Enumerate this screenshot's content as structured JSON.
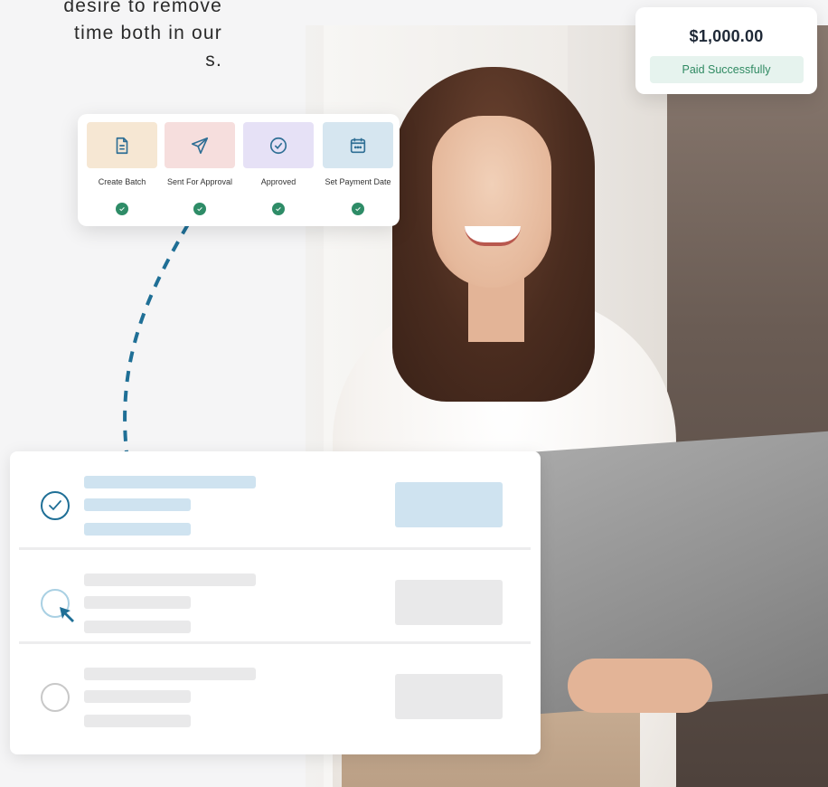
{
  "intro": {
    "lines": [
      "desire to remove",
      "time both in our",
      "s."
    ]
  },
  "payment": {
    "amount": "$1,000.00",
    "status": "Paid Successfully"
  },
  "workflow": {
    "steps": [
      {
        "label": "Create Batch",
        "icon": "document-icon",
        "tile_color": "#f6e7d3",
        "icon_color": "#2f6f95"
      },
      {
        "label": "Sent For Approval",
        "icon": "send-icon",
        "tile_color": "#f6dedd",
        "icon_color": "#2f6f95"
      },
      {
        "label": "Approved",
        "icon": "check-circle-icon",
        "tile_color": "#e6e1f6",
        "icon_color": "#2f6f95"
      },
      {
        "label": "Set Payment Date",
        "icon": "calendar-icon",
        "tile_color": "#d6e6f0",
        "icon_color": "#2f6f95"
      }
    ],
    "completed_color": "#2e8c67"
  },
  "list": {
    "rows": [
      {
        "state": "checked"
      },
      {
        "state": "hover"
      },
      {
        "state": "unchecked"
      }
    ]
  },
  "colors": {
    "accent": "#1f6f96",
    "placeholder_active": "#cfe3f0",
    "placeholder": "#e9e9ea"
  }
}
